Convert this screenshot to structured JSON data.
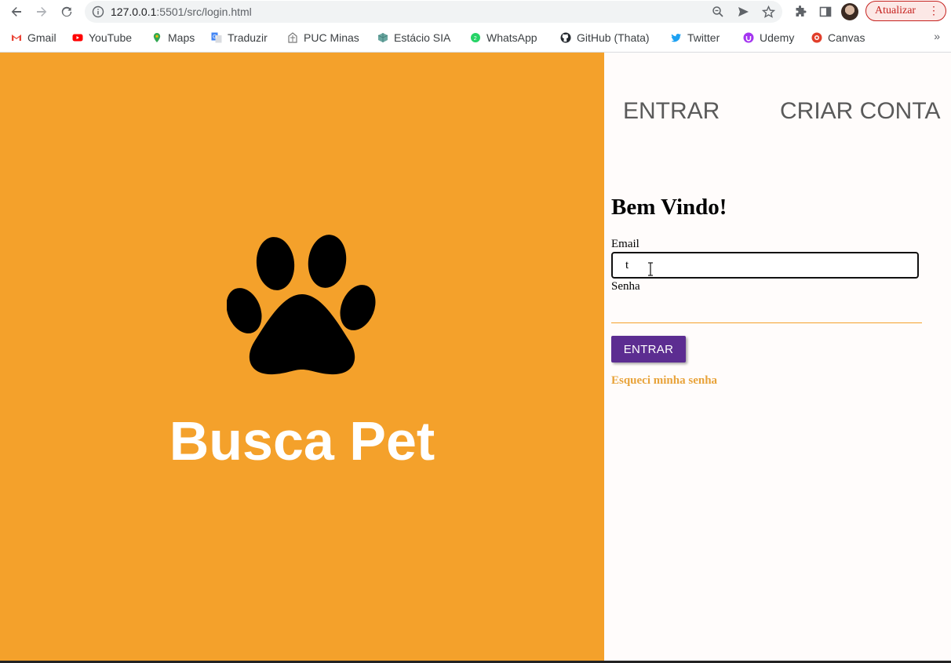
{
  "browser": {
    "url_host": "127.0.0.1",
    "url_rest": ":5501/src/login.html",
    "update_label": "Atualizar",
    "bookmarks": [
      {
        "label": "Gmail",
        "icon": "gmail-icon",
        "color": "#ea4335"
      },
      {
        "label": "YouTube",
        "icon": "youtube-icon",
        "color": "#ff0000"
      },
      {
        "label": "Maps",
        "icon": "maps-icon",
        "color": "#34a853"
      },
      {
        "label": "Traduzir",
        "icon": "translate-icon",
        "color": "#4285f4"
      },
      {
        "label": "PUC Minas",
        "icon": "puc-minas-icon",
        "color": "#8a8a8a"
      },
      {
        "label": "Estácio SIA",
        "icon": "estacio-icon",
        "color": "#6aa6a0"
      },
      {
        "label": "WhatsApp",
        "icon": "whatsapp-icon",
        "color": "#25d366"
      },
      {
        "label": "GitHub (Thata)",
        "icon": "github-icon",
        "color": "#24292e"
      },
      {
        "label": "Twitter",
        "icon": "twitter-icon",
        "color": "#1da1f2"
      },
      {
        "label": "Udemy",
        "icon": "udemy-icon",
        "color": "#a435f0"
      },
      {
        "label": "Canvas",
        "icon": "canvas-icon",
        "color": "#e13f2b"
      }
    ],
    "more": "»"
  },
  "hero": {
    "brand": "Busca Pet",
    "background": "#f4a12b"
  },
  "auth": {
    "tab_login": "ENTRAR",
    "tab_signup": "CRIAR CONTA",
    "welcome": "Bem Vindo!",
    "email_label": "Email",
    "email_value": "t",
    "password_label": "Senha",
    "submit_label": "ENTRAR",
    "forgot_label": "Esqueci minha senha",
    "accent": "#5c2d91",
    "link_color": "#e8a33a"
  }
}
